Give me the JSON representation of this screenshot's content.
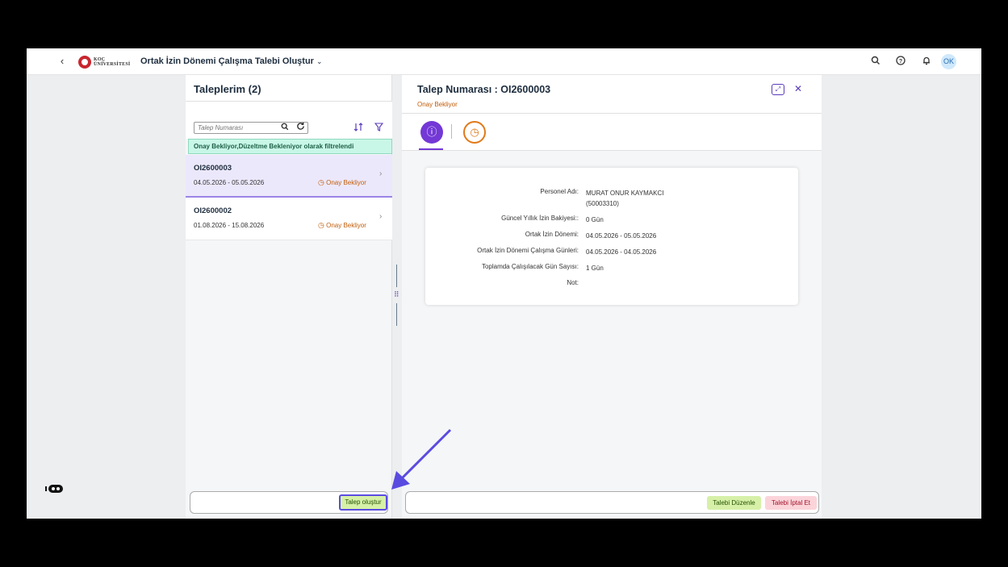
{
  "shell": {
    "back": "‹",
    "logo_line1": "KOÇ",
    "logo_line2": "ÜNİVERSİTESİ",
    "app_title": "Ortak İzin Dönemi Çalışma Talebi Oluştur",
    "title_chevron": "⌄",
    "avatar_initials": "OK"
  },
  "list": {
    "title": "Taleplerim (2)",
    "search_placeholder": "Talep Numarası",
    "filter_info": "Onay Bekliyor,Düzeltme Bekleniyor olarak filtrelendi",
    "items": [
      {
        "id": "OI2600003",
        "dates": "04.05.2026 - 05.05.2026",
        "status": "Onay Bekliyor"
      },
      {
        "id": "OI2600002",
        "dates": "01.08.2026 - 15.08.2026",
        "status": "Onay Bekliyor"
      }
    ],
    "create_button": "Talep oluştur"
  },
  "detail": {
    "title": "Talep Numarası : OI2600003",
    "status": "Onay Bekliyor",
    "fields": [
      {
        "label": "Personel Adı:",
        "value": "MURAT ONUR KAYMAKCI (50003310)"
      },
      {
        "label": "Güncel Yıllık İzin Bakiyesi::",
        "value": "0 Gün"
      },
      {
        "label": "Ortak İzin Dönemi:",
        "value": "04.05.2026 - 05.05.2026"
      },
      {
        "label": "Ortak İzin Dönemi Çalışma Günleri:",
        "value": "04.05.2026 - 04.05.2026"
      },
      {
        "label": "Toplamda Çalışılacak Gün Sayısı:",
        "value": "1 Gün"
      },
      {
        "label": "Not:",
        "value": ""
      }
    ],
    "edit_button": "Talebi Düzenle",
    "cancel_button": "Talebi İptal Et"
  },
  "colors": {
    "accent": "#5a3bbd",
    "status_orange": "#c25e0b",
    "filter_bg": "#c8f7e8",
    "selected_bg": "#ece8fb",
    "create_bg": "#d6f0a8",
    "cancel_bg": "#fbd4da",
    "arrow": "#5a4be0"
  },
  "icons": {
    "search": "search-icon",
    "help": "help-icon",
    "notification": "bell-icon",
    "sort": "sort-icon",
    "filter": "filter-icon",
    "refresh": "refresh-icon",
    "info": "info-icon",
    "history": "history-icon",
    "fullscreen": "fullscreen-icon",
    "close": "close-icon"
  }
}
